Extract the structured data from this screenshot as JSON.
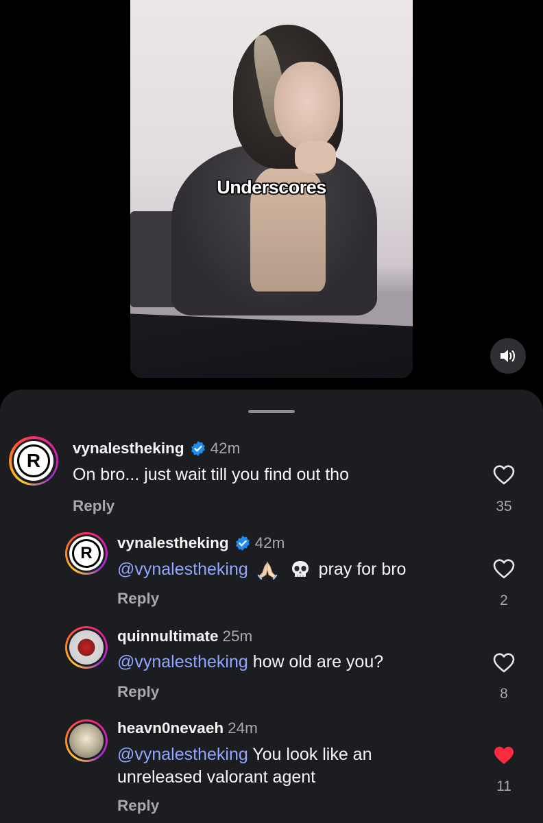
{
  "video": {
    "caption": "Underscores"
  },
  "comments": [
    {
      "username": "vynalestheking",
      "verified": true,
      "time": "42m",
      "text": "On bro... just wait till you find out tho",
      "reply_label": "Reply",
      "likes": "35",
      "liked": false
    },
    {
      "username": "vynalestheking",
      "verified": true,
      "time": "42m",
      "mention": "@vynalestheking",
      "text": "pray for bro",
      "emojis": [
        "folded-hands",
        "skull"
      ],
      "reply_label": "Reply",
      "likes": "2",
      "liked": false
    },
    {
      "username": "quinnultimate",
      "time": "25m",
      "mention": "@vynalestheking",
      "text": "how old are you?",
      "reply_label": "Reply",
      "likes": "8",
      "liked": false
    },
    {
      "username": "heavn0nevaeh",
      "time": "24m",
      "mention": "@vynalestheking",
      "text_line1": "You look like an",
      "text_line2": "unreleased valorant agent",
      "reply_label": "Reply",
      "likes": "11",
      "liked": true
    }
  ],
  "colors": {
    "background": "#000000",
    "sheet": "#1c1d21",
    "mention": "#8fa7ff",
    "verified": "#1d8cf5",
    "liked_heart": "#ff2a40",
    "secondary_text": "#a8a8ad"
  }
}
